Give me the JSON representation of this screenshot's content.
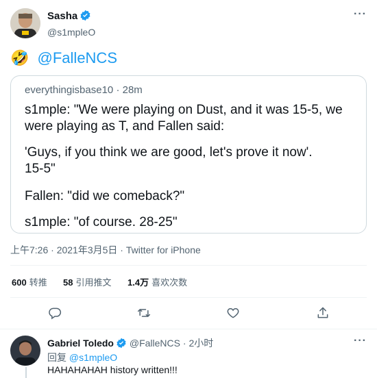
{
  "tweet": {
    "author_name": "Sasha",
    "author_handle": "@s1mpleO",
    "emoji": "🤣",
    "mention": "@FalleNCS",
    "quote": {
      "author": "everythingisbase10",
      "time": "28m",
      "paragraphs": [
        "s1mple: \"We were playing on Dust, and it was 15-5, we were playing as T, and Fallen said:",
        "'Guys, if you think we are good, let's prove it now'.\n15-5\"",
        "Fallen: \"did we comeback?\"",
        "s1mple: \"of course. 28-25\""
      ]
    },
    "timestamp": "上午7:26 · 2021年3月5日 · Twitter for iPhone",
    "stats": {
      "retweets_num": "600",
      "retweets_label": "转推",
      "quotes_num": "58",
      "quotes_label": "引用推文",
      "likes_num": "1.4万",
      "likes_label": "喜欢次数"
    },
    "actions": [
      "reply-icon",
      "retweet-icon",
      "like-icon",
      "share-icon"
    ]
  },
  "reply": {
    "author_name": "Gabriel Toledo",
    "author_handle": "@FalleNCS",
    "time": "· 2小时",
    "replying_prefix": "回复",
    "replying_to": "@s1mpleO",
    "text": "HAHAHAHAH history written!!!"
  },
  "colors": {
    "accent": "#1d9bf0",
    "text": "#0f1419",
    "muted": "#536471",
    "border": "#cfd9de"
  }
}
